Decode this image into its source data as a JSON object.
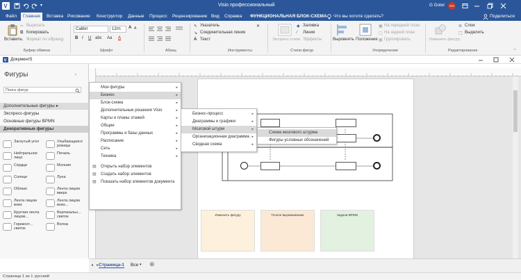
{
  "titlebar": {
    "title": "Visio профессиональный",
    "user": "G Goter",
    "avatar": "GG"
  },
  "tabs": {
    "file": "Файл",
    "home": "Главная",
    "insert": "Вставка",
    "draw": "Рисование",
    "designer": "Конструктор",
    "data": "Данные",
    "process": "Процесс",
    "review": "Рецензирование",
    "view": "Вид",
    "help": "Справка",
    "context": "ФУНКЦИОНАЛЬНАЯ БЛОК-СХЕМА",
    "tellme": "Что вы хотите сделать?",
    "share": "Поделиться"
  },
  "ribbon": {
    "paste": "Вставить",
    "cut": "Вырезать",
    "copy": "Копировать",
    "format_painter": "Формат по образцу",
    "font_name": "Calibri",
    "font_size": "12пт.",
    "pointer": "Указатель",
    "connector": "Соединительная линия",
    "text": "Текст",
    "express_styles": "Экспресс-стили",
    "fill": "Заливка",
    "line": "Линия",
    "effects": "Эффекты",
    "align": "Выровнять",
    "position": "Положение",
    "to_front": "На передний план",
    "to_back": "На задний план",
    "group": "Группировать",
    "change_shape": "Изменить фигуру",
    "layers": "Слои",
    "select": "Выделить",
    "groups": {
      "clipboard": "Буфер обмена",
      "font": "Шрифт",
      "paragraph": "Абзац",
      "tools": "Инструменты",
      "shape_styles": "Стили фигур",
      "arrange": "Упорядочение",
      "editing": "Редактирование"
    }
  },
  "document": {
    "name": "Документ5"
  },
  "shapes_pane": {
    "title": "Фигуры",
    "search_placeholder": "Поиск фигур",
    "stencils": [
      "Дополнительные фигуры",
      "Экспресс-фигуры",
      "Основные фигуры BPMN",
      "Декоративные фигуры"
    ],
    "shapes": [
      [
        "Загнутый угол",
        "Улыбающаяся рожица"
      ],
      [
        "Нейтральное лицо",
        "Печаль"
      ],
      [
        "Сердце",
        "Молния"
      ],
      [
        "Солнце",
        "Луна"
      ],
      [
        "Облако",
        "Лента лицом вверх"
      ],
      [
        "Лента лицом вниз",
        "Лента лицом вниз..."
      ],
      [
        "Круглая лента лицом...",
        "Вертикальн... свиток"
      ],
      [
        "Горизонт... свиток",
        "Волна"
      ]
    ]
  },
  "menu1": {
    "items": [
      "Мои фигуры",
      "Бизнес",
      "Блок-схема",
      "Дополнительные решения Visio",
      "Карты и планы этажей",
      "Общие",
      "Программы и базы данных",
      "Расписание",
      "Сеть",
      "Техника",
      "Открыть набор элементов",
      "Создать набор элементов",
      "Показать набор элементов документа"
    ]
  },
  "menu2": {
    "items": [
      "Бизнес-процесс",
      "Диаграммы и графики",
      "Мозговой штурм",
      "Организационная диаграмма",
      "Сводная схема"
    ]
  },
  "menu3": {
    "items": [
      "Схема мозгового штурма",
      "Фигуры условных обозначений"
    ]
  },
  "diagram": {
    "cards": [
      {
        "title": "Изменить фигуру"
      },
      {
        "title": "Точное выравнивание"
      },
      {
        "title": "Задачи BPMN"
      }
    ]
  },
  "bottom": {
    "page_tab": "Страница-1",
    "all_tab": "Все"
  },
  "status": {
    "page": "Страница 1 из 1",
    "language": "русский"
  },
  "colors": {
    "brand": "#2b579a",
    "avatar": "#c0392b",
    "card1": "#fdf0dc",
    "card2": "#fbe9d5",
    "card3": "#e3f1e0"
  }
}
